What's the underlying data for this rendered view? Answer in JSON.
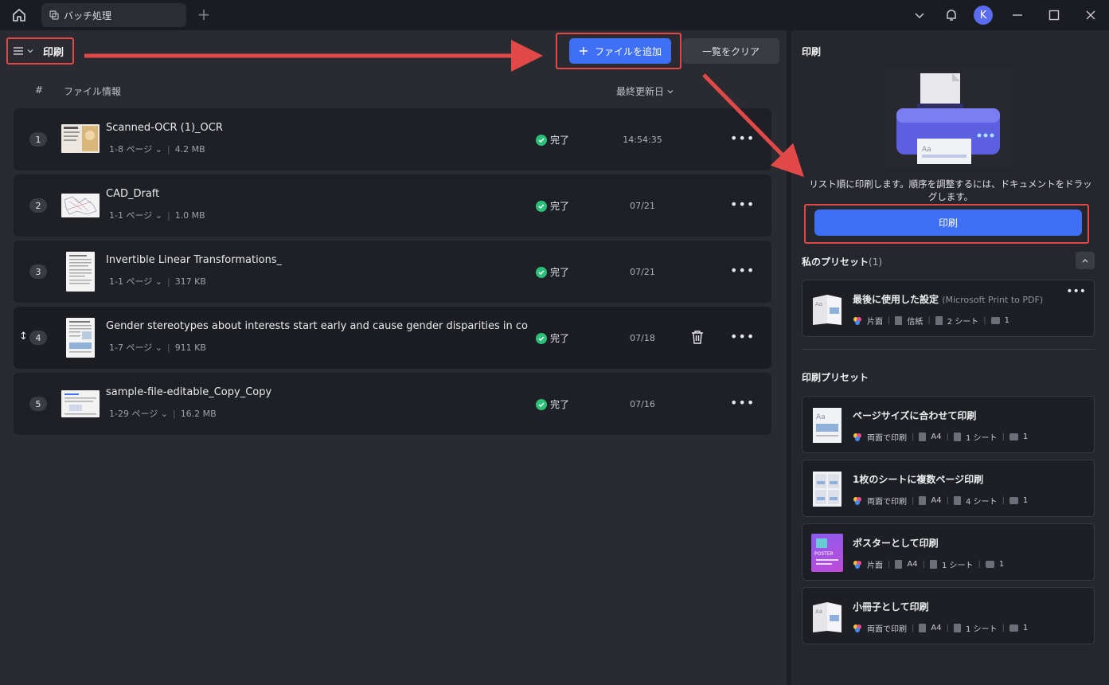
{
  "titlebar": {
    "tab_label": "バッチ処理",
    "avatar_letter": "K"
  },
  "toolbar": {
    "mode_title": "印刷",
    "add_files_label": "ファイルを追加",
    "clear_list_label": "一覧をクリア"
  },
  "list": {
    "col_number": "#",
    "col_file_info": "ファイル情報",
    "col_modified": "最終更新日",
    "rows": [
      {
        "num": "1",
        "name": "Scanned-OCR (1)_OCR",
        "pages": "1-8 ページ",
        "size": "4.2 MB",
        "status": "完了",
        "date": "14:54:35"
      },
      {
        "num": "2",
        "name": "CAD_Draft",
        "pages": "1-1 ページ",
        "size": "1.0 MB",
        "status": "完了",
        "date": "07/21"
      },
      {
        "num": "3",
        "name": "Invertible Linear Transformations_",
        "pages": "1-1 ページ",
        "size": "317 KB",
        "status": "完了",
        "date": "07/21"
      },
      {
        "num": "4",
        "name": "Gender stereotypes about interests start early and cause gender disparities in comp...",
        "pages": "1-7 ページ",
        "size": "911 KB",
        "status": "完了",
        "date": "07/18"
      },
      {
        "num": "5",
        "name": "sample-file-editable_Copy_Copy",
        "pages": "1-29 ページ",
        "size": "16.2 MB",
        "status": "完了",
        "date": "07/16"
      }
    ]
  },
  "panel": {
    "title": "印刷",
    "description": "リスト順に印刷します。順序を調整するには、ドキュメントをドラッグします。",
    "print_label": "印刷",
    "my_presets_label": "私のプリセット",
    "my_presets_count": "(1)",
    "my_presets": [
      {
        "title": "最後に使用した設定",
        "subtitle": "(Microsoft Print to PDF)",
        "sides": "片面",
        "paper": "信紙",
        "sheets": "2 シート",
        "copies": "1"
      }
    ],
    "print_presets_label": "印刷プリセット",
    "print_presets": [
      {
        "title": "ページサイズに合わせて印刷",
        "sides": "両面で印刷",
        "paper": "A4",
        "sheets": "1 シート",
        "copies": "1"
      },
      {
        "title": "1枚のシートに複数ページ印刷",
        "sides": "両面で印刷",
        "paper": "A4",
        "sheets": "4 シート",
        "copies": "1"
      },
      {
        "title": "ポスターとして印刷",
        "sides": "片面",
        "paper": "A4",
        "sheets": "1 シート",
        "copies": "1",
        "thumb_text": "POSTER"
      },
      {
        "title": "小冊子として印刷",
        "sides": "両面で印刷",
        "paper": "A4",
        "sheets": "1 シート",
        "copies": "1"
      }
    ]
  },
  "colors": {
    "accent": "#3f6ff4",
    "highlight": "#e14848",
    "success": "#2bbf7a"
  }
}
